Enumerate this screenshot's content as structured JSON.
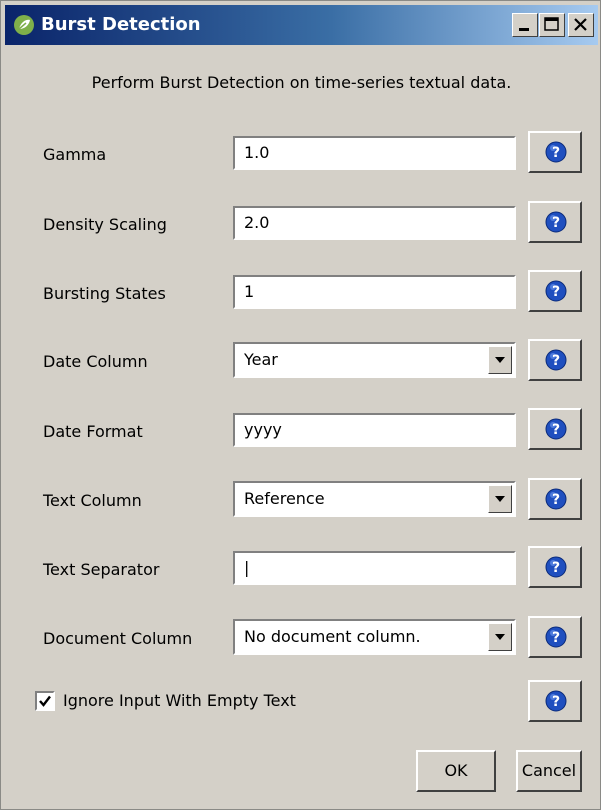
{
  "window": {
    "title": "Burst Detection",
    "description": "Perform Burst Detection on time-series textual data."
  },
  "fields": {
    "gamma": {
      "label": "Gamma",
      "value": "1.0"
    },
    "density_scaling": {
      "label": "Density Scaling",
      "value": "2.0"
    },
    "bursting_states": {
      "label": "Bursting States",
      "value": "1"
    },
    "date_column": {
      "label": "Date Column",
      "value": "Year"
    },
    "date_format": {
      "label": "Date Format",
      "value": "yyyy"
    },
    "text_column": {
      "label": "Text Column",
      "value": "Reference"
    },
    "text_separator": {
      "label": "Text Separator",
      "value": "|"
    },
    "document_column": {
      "label": "Document Column",
      "value": "No document column."
    }
  },
  "ignore_empty": {
    "label": "Ignore Input With Empty Text",
    "checked": true
  },
  "buttons": {
    "ok": "OK",
    "cancel": "Cancel"
  },
  "icons": {
    "app": "leaf-icon",
    "help": "question-icon"
  },
  "colors": {
    "titlebar": "#0a246a",
    "face": "#d4d0c8",
    "help_blue": "#1f4fbf"
  }
}
